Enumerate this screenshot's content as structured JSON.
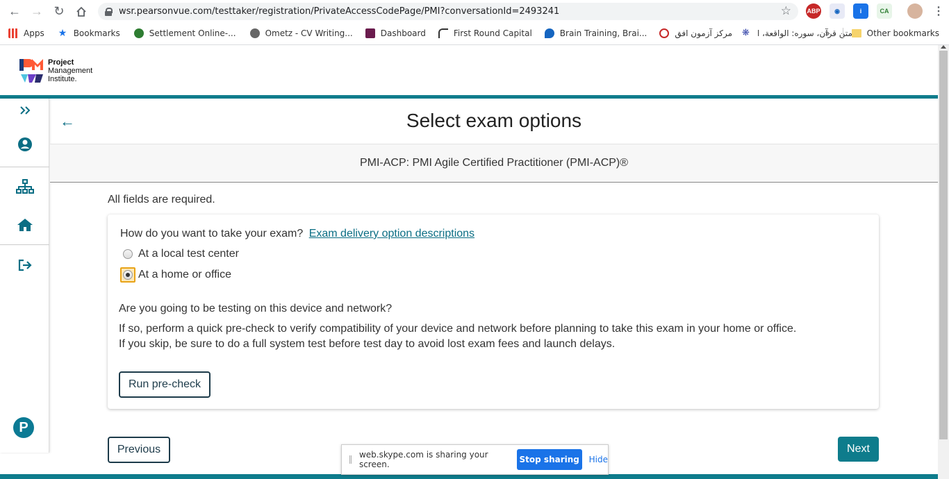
{
  "browser": {
    "url": "wsr.pearsonvue.com/testtaker/registration/PrivateAccessCodePage/PMI?conversationId=2493241",
    "bookmarks": [
      {
        "label": "Apps",
        "color": "#4285f4"
      },
      {
        "label": "Bookmarks",
        "color": "#1a73e8"
      },
      {
        "label": "Settlement Online-...",
        "color": "#2e7d32"
      },
      {
        "label": "Ometz - CV Writing...",
        "color": "#555555"
      },
      {
        "label": "Dashboard",
        "color": "#6a1b4d"
      },
      {
        "label": "First Round Capital",
        "color": "#333333"
      },
      {
        "label": "Brain Training, Brai...",
        "color": "#1565c0"
      },
      {
        "label": "مرکز آزمون افق",
        "color": "#c62828"
      },
      {
        "label": "متن قرآن، سوره: الواقعة، ا...",
        "color": "#3949ab"
      }
    ],
    "more_label": "»",
    "other_bookmarks": "Other bookmarks",
    "ext_abp": "ABP"
  },
  "header": {
    "logo_line1": "Project",
    "logo_line2": "Management",
    "logo_line3": "Institute."
  },
  "main": {
    "title": "Select exam options",
    "exam_name": "PMI-ACP: PMI Agile Certified Practitioner (PMI-ACP)®",
    "required_note": "All fields are required.",
    "question": "How do you want to take your exam?",
    "question_link": "Exam delivery option descriptions",
    "options": [
      {
        "label": "At a local test center",
        "checked": false
      },
      {
        "label": "At a home or office",
        "checked": true
      }
    ],
    "device_question": "Are you going to be testing on this device and network?",
    "device_line1": "If so, perform a quick pre-check to verify compatibility of your device and network before planning to take this exam in your home or office.",
    "device_line2": "If you skip, be sure to do a full system test before test day to avoid lost exam fees and launch delays.",
    "precheck_label": "Run pre-check",
    "previous_label": "Previous",
    "next_label": "Next"
  },
  "sidebar": {
    "brand_letter": "P"
  },
  "share_banner": {
    "text": "web.skype.com is sharing your screen.",
    "stop_label": "Stop sharing",
    "hide_label": "Hide"
  },
  "colors": {
    "teal": "#0e7c8c",
    "dark_navy": "#1d3b4a",
    "link": "#0b6e84",
    "focus_orange": "#e8a317"
  }
}
